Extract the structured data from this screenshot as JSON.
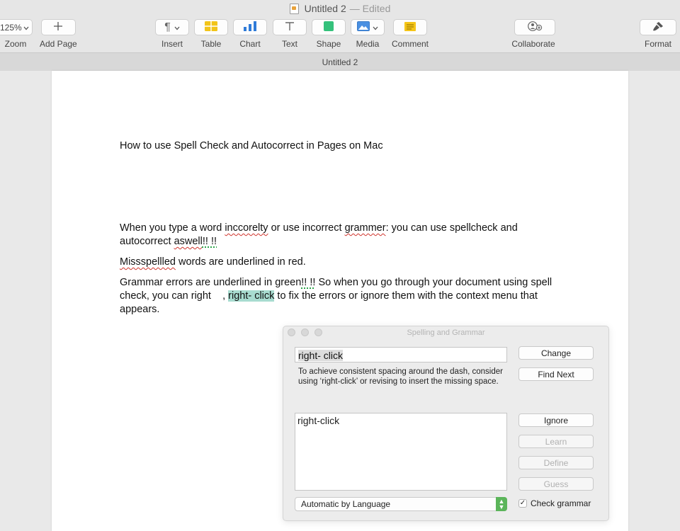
{
  "window": {
    "title": "Untitled 2",
    "status": "— Edited",
    "tab_title": "Untitled 2"
  },
  "toolbar": {
    "zoom_value": "125%",
    "zoom_label": "Zoom",
    "add_page_label": "Add Page",
    "insert_label": "Insert",
    "table_label": "Table",
    "chart_label": "Chart",
    "text_label": "Text",
    "shape_label": "Shape",
    "media_label": "Media",
    "comment_label": "Comment",
    "collaborate_label": "Collaborate",
    "format_label": "Format"
  },
  "document": {
    "heading": "How to use Spell Check and Autocorrect in Pages on Mac",
    "p1": {
      "a": "When you type a word ",
      "err1": "inccorelty",
      "b": " or use incorrect ",
      "err2": "grammer",
      "c": ": you can use spellcheck and autocorrect ",
      "err3": "aswell",
      "d": "!! !!"
    },
    "p2": {
      "err": "Missspellled",
      "rest": " words are underlined in red."
    },
    "p3": {
      "a": "Grammar errors are underlined in green",
      "err": "!! !!",
      "b": " So when you go through your document using spell check, you can right    , ",
      "hl": "right- click",
      "c": " to fix the errors or ignore them with the context menu that appears."
    }
  },
  "spelling_panel": {
    "title": "Spelling and Grammar",
    "current_word": "right- click",
    "advice": "To achieve consistent spacing around the dash, consider using ‘right-click’ or revising to insert the missing space.",
    "suggestions": [
      "right-click"
    ],
    "buttons": {
      "change": "Change",
      "find_next": "Find Next",
      "ignore": "Ignore",
      "learn": "Learn",
      "define": "Define",
      "guess": "Guess"
    },
    "language": "Automatic by Language",
    "check_grammar_label": "Check grammar",
    "check_grammar_checked": true
  }
}
